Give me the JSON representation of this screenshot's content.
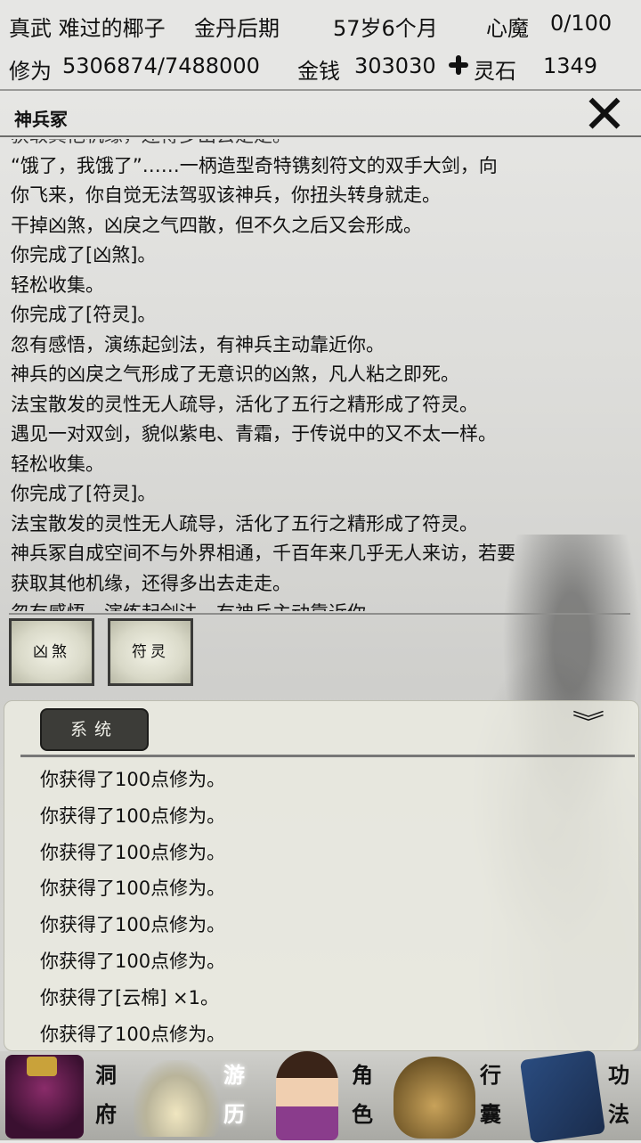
{
  "status": {
    "name": "真武 难过的椰子",
    "realm": "金丹后期",
    "age": "57岁6个月",
    "heart_demon_label": "心魔",
    "heart_demon_value": "0/100",
    "cultivation_label": "修为",
    "cultivation_value": "5306874/7488000",
    "money_label": "金钱",
    "money_value": "303030",
    "spirit_stone_label": "灵石",
    "spirit_stone_value": "1349"
  },
  "event": {
    "title": "神兵冢",
    "log_lines": [
      "获取其他机缘，还得多出去走走。",
      "“饿了，我饿了”……一柄造型奇特镌刻符文的双手大剑，向",
      "你飞来，你自觉无法驾驭该神兵，你扭头转身就走。",
      "干掉凶煞，凶戾之气四散，但不久之后又会形成。",
      "你完成了[凶煞]。",
      "轻松收集。",
      "你完成了[符灵]。",
      "忽有感悟，演练起剑法，有神兵主动靠近你。",
      "神兵的凶戾之气形成了无意识的凶煞，凡人粘之即死。",
      "法宝散发的灵性无人疏导，活化了五行之精形成了符灵。",
      "遇见一对双剑，貌似紫电、青霜，于传说中的又不太一样。",
      "轻松收集。",
      "你完成了[符灵]。",
      "法宝散发的灵性无人疏导，活化了五行之精形成了符灵。",
      "神兵冢自成空间不与外界相通，千百年来几乎无人来访，若要",
      "获取其他机缘，还得多出去走走。",
      "忽有感悟，演练起剑法，有神兵主动靠近你。"
    ],
    "choices": [
      "凶煞",
      "符灵"
    ]
  },
  "system": {
    "tab_label": "系统",
    "messages": [
      "你获得了100点修为。",
      "你获得了100点修为。",
      "你获得了100点修为。",
      "你获得了100点修为。",
      "你获得了100点修为。",
      "你获得了100点修为。",
      "你获得了[云棉] ×1。",
      "你获得了100点修为。"
    ]
  },
  "nav": {
    "cave": [
      "洞",
      "府"
    ],
    "travel": [
      "游",
      "历"
    ],
    "character": [
      "角",
      "色"
    ],
    "bag": [
      "行",
      "囊"
    ],
    "skills": [
      "功",
      "法"
    ]
  },
  "icons": {
    "close": "close-x-icon",
    "spirit_stone": "spirit-stone-icon",
    "collapse": "double-chevron-down-icon"
  }
}
